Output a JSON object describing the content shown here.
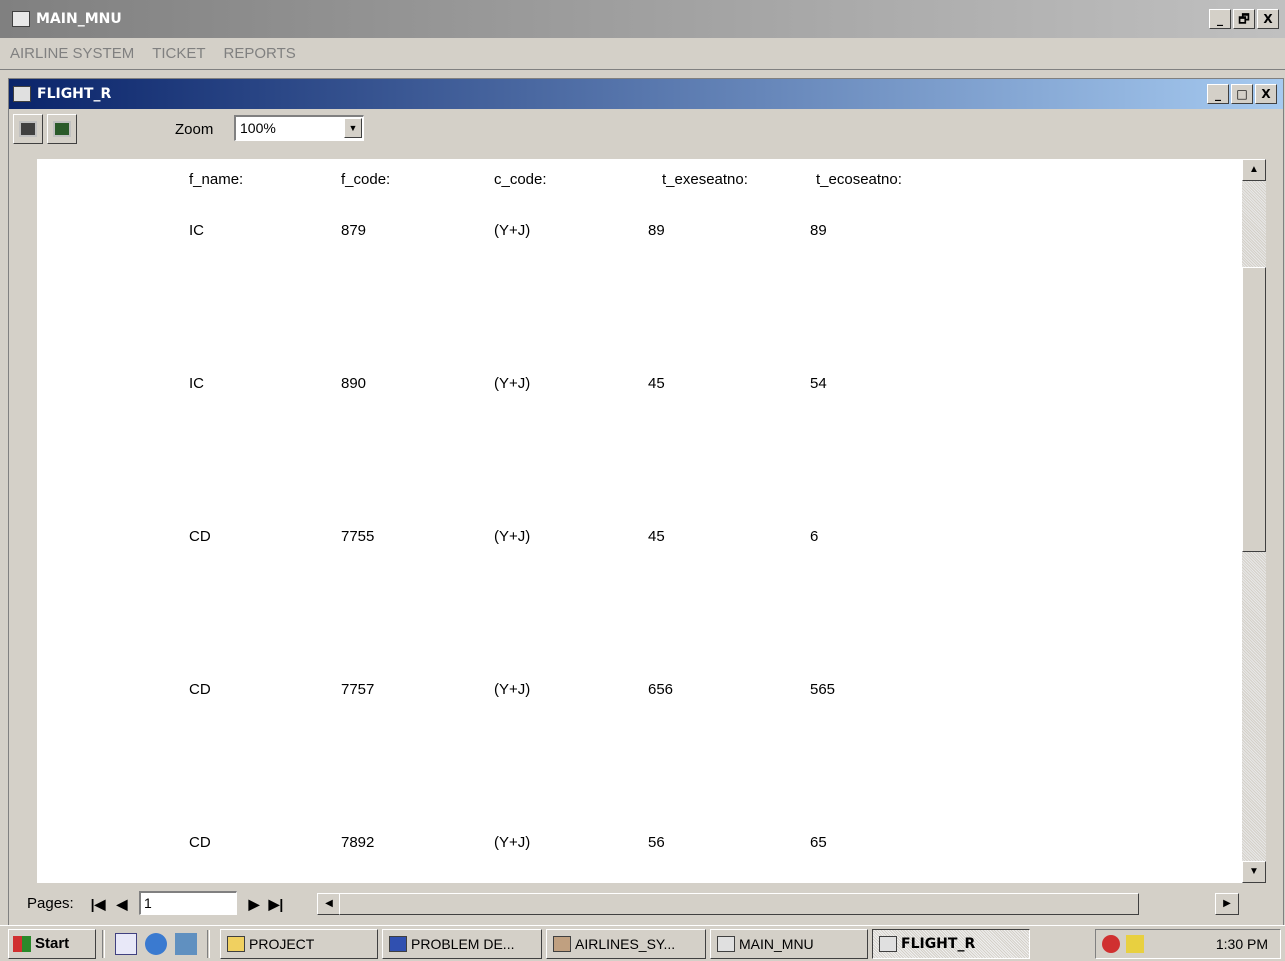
{
  "main_window": {
    "title": "MAIN_MNU",
    "buttons": [
      "_",
      "🗗",
      "X"
    ]
  },
  "menubar": {
    "items": [
      "AIRLINE SYSTEM",
      "TICKET",
      "REPORTS"
    ]
  },
  "child_window": {
    "title": "FLIGHT_R",
    "buttons": [
      "_",
      "□",
      "X"
    ]
  },
  "toolbar": {
    "zoom_label": "Zoom",
    "zoom_value": "100%"
  },
  "report": {
    "headers": [
      "f_name:",
      "f_code:",
      "c_code:",
      "t_exeseatno:",
      "t_ecoseatno:"
    ],
    "rows": [
      [
        "IC",
        "879",
        "(Y+J)",
        "89",
        "89"
      ],
      [
        "IC",
        "890",
        "(Y+J)",
        "45",
        "54"
      ],
      [
        "CD",
        "7755",
        "(Y+J)",
        "45",
        "6"
      ],
      [
        "CD",
        "7757",
        "(Y+J)",
        "656",
        "565"
      ],
      [
        "CD",
        "7892",
        "(Y+J)",
        "56",
        "65"
      ]
    ]
  },
  "navbar": {
    "pages_label": "Pages:",
    "page_value": "1"
  },
  "taskbar": {
    "start_label": "Start",
    "tasks": [
      "PROJECT",
      "PROBLEM DE...",
      "AIRLINES_SY...",
      "MAIN_MNU",
      "FLIGHT_R"
    ],
    "clock": "1:30 PM"
  },
  "colors": {
    "child_title_start": "#0a246a",
    "child_title_end": "#a6caf0",
    "face": "#d4d0c8"
  }
}
